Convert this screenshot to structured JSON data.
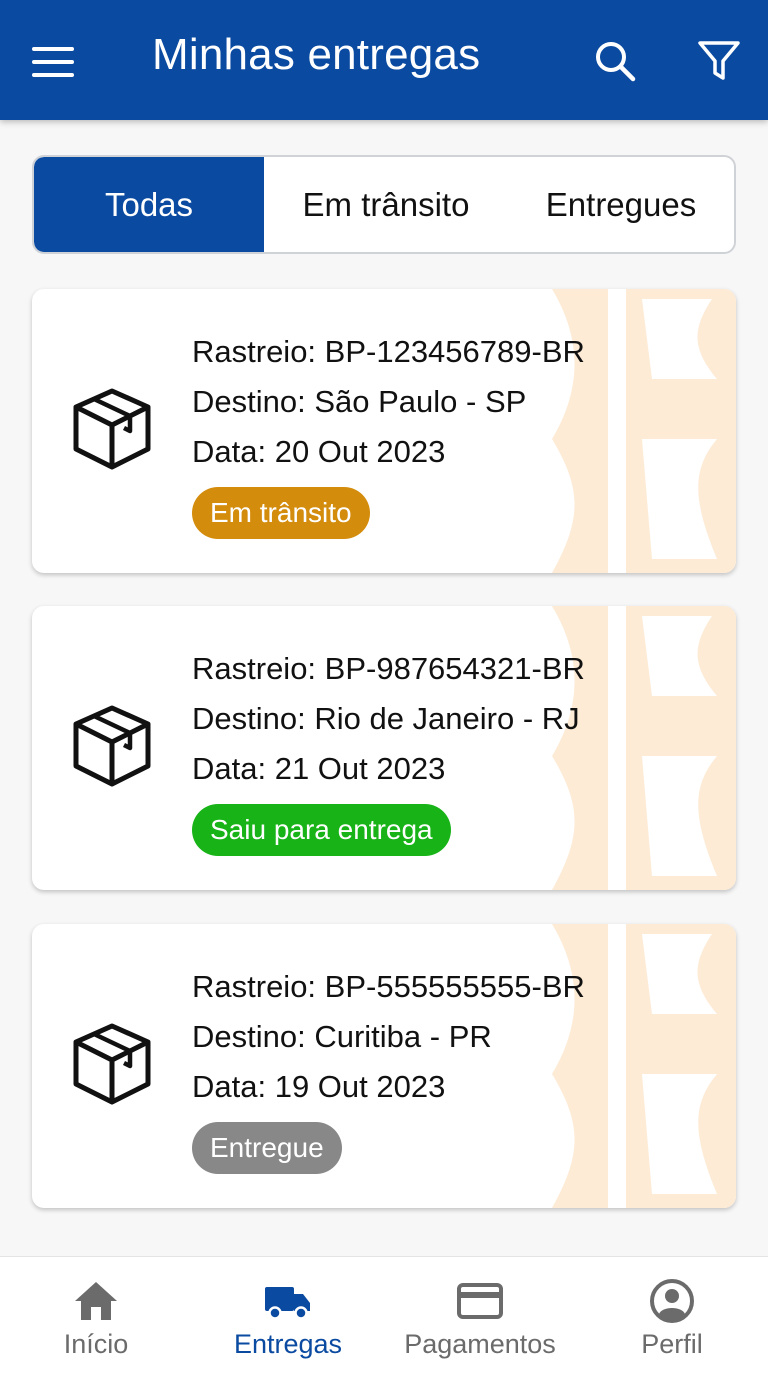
{
  "header": {
    "title": "Minhas entregas"
  },
  "tabs": [
    {
      "label": "Todas",
      "active": true
    },
    {
      "label": "Em trânsito",
      "active": false
    },
    {
      "label": "Entregues",
      "active": false
    }
  ],
  "deliveries": [
    {
      "tracking": "Rastreio: BP-123456789-BR",
      "destination": "Destino: São Paulo - SP",
      "date": "Data: 20 Out 2023",
      "status": "Em trânsito",
      "status_color": "#d48c0c"
    },
    {
      "tracking": "Rastreio: BP-987654321-BR",
      "destination": "Destino: Rio de Janeiro - RJ",
      "date": "Data: 21 Out 2023",
      "status": "Saiu para entrega",
      "status_color": "#17b317"
    },
    {
      "tracking": "Rastreio: BP-555555555-BR",
      "destination": "Destino: Curitiba - PR",
      "date": "Data: 19 Out 2023",
      "status": "Entregue",
      "status_color": "#888888"
    }
  ],
  "bottom_nav": [
    {
      "label": "Início",
      "icon": "home-icon",
      "active": false
    },
    {
      "label": "Entregas",
      "icon": "truck-icon",
      "active": true
    },
    {
      "label": "Pagamentos",
      "icon": "credit-card-icon",
      "active": false
    },
    {
      "label": "Perfil",
      "icon": "account-circle-icon",
      "active": false
    }
  ],
  "colors": {
    "primary": "#0a4aa0",
    "watermark": "#fdebd6",
    "inactive_nav": "#6b6b6b"
  }
}
